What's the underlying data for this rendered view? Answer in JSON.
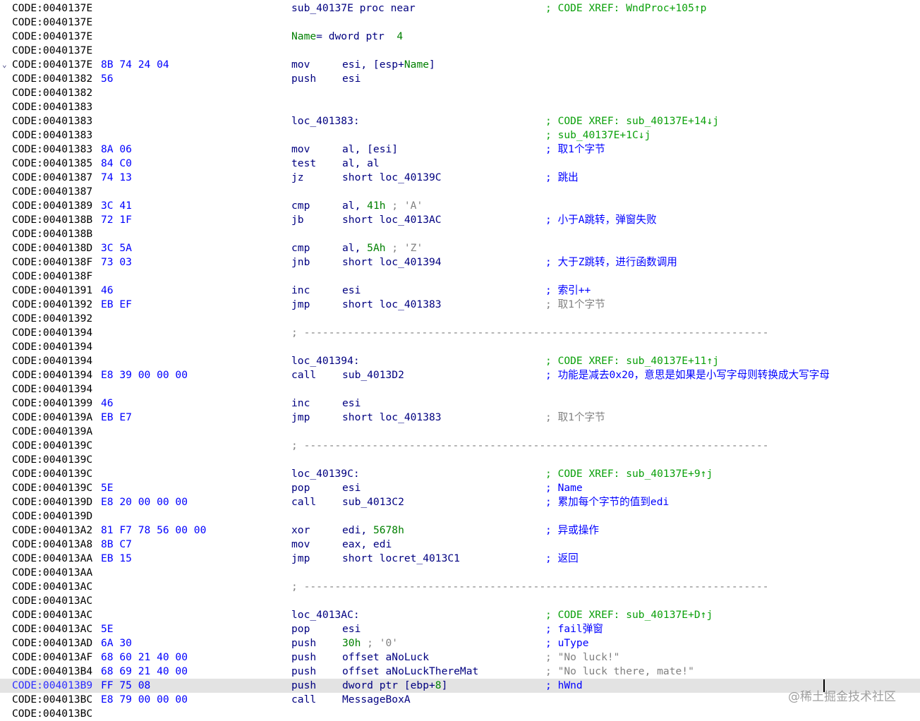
{
  "watermark": "@稀土掘金技术社区",
  "lines": [
    {
      "addr": "CODE:0040137E",
      "label": "sub_40137E proc near",
      "comment": [
        {
          "t": "; CODE XREF: WndProc+105↑p",
          "c": "gr"
        }
      ]
    },
    {
      "addr": "CODE:0040137E"
    },
    {
      "addr": "CODE:0040137E",
      "labelParts": [
        {
          "t": "Name",
          "c": "var"
        },
        {
          "t": "= dword ptr  "
        },
        {
          "t": "4",
          "c": "num"
        }
      ]
    },
    {
      "addr": "CODE:0040137E"
    },
    {
      "addr": "CODE:0040137E",
      "fold": "⌄",
      "bytes": "8B 74 24 04",
      "mnem": "mov",
      "ops": [
        {
          "t": "esi, [esp+"
        },
        {
          "t": "Name",
          "c": "var"
        },
        {
          "t": "]"
        }
      ]
    },
    {
      "addr": "CODE:00401382",
      "bytes": "56",
      "mnem": "push",
      "ops": [
        {
          "t": "esi"
        }
      ]
    },
    {
      "addr": "CODE:00401382"
    },
    {
      "addr": "CODE:00401383"
    },
    {
      "addr": "CODE:00401383",
      "label": "loc_401383:",
      "comment": [
        {
          "t": "; CODE XREF: sub_40137E+14↓j",
          "c": "gr"
        }
      ]
    },
    {
      "addr": "CODE:00401383",
      "comment": [
        {
          "t": "; sub_40137E+1C↓j",
          "c": "gr"
        }
      ]
    },
    {
      "addr": "CODE:00401383",
      "bytes": "8A 06",
      "mnem": "mov",
      "ops": [
        {
          "t": "al, [esi]"
        }
      ],
      "comment": [
        {
          "t": "; 取1个字节",
          "c": "cm"
        }
      ]
    },
    {
      "addr": "CODE:00401385",
      "bytes": "84 C0",
      "mnem": "test",
      "ops": [
        {
          "t": "al, al"
        }
      ]
    },
    {
      "addr": "CODE:00401387",
      "bytes": "74 13",
      "mnem": "jz",
      "ops": [
        {
          "t": "short loc_40139C"
        }
      ],
      "comment": [
        {
          "t": "; 跳出",
          "c": "cm"
        }
      ]
    },
    {
      "addr": "CODE:00401387"
    },
    {
      "addr": "CODE:00401389",
      "bytes": "3C 41",
      "mnem": "cmp",
      "ops": [
        {
          "t": "al, "
        },
        {
          "t": "41h",
          "c": "num"
        },
        {
          "t": " ; 'A'",
          "c": "sc"
        }
      ]
    },
    {
      "addr": "CODE:0040138B",
      "bytes": "72 1F",
      "mnem": "jb",
      "ops": [
        {
          "t": "short loc_4013AC"
        }
      ],
      "comment": [
        {
          "t": "; 小于A跳转，弹窗失败",
          "c": "cm"
        }
      ]
    },
    {
      "addr": "CODE:0040138B"
    },
    {
      "addr": "CODE:0040138D",
      "bytes": "3C 5A",
      "mnem": "cmp",
      "ops": [
        {
          "t": "al, "
        },
        {
          "t": "5Ah",
          "c": "num"
        },
        {
          "t": " ; 'Z'",
          "c": "sc"
        }
      ]
    },
    {
      "addr": "CODE:0040138F",
      "bytes": "73 03",
      "mnem": "jnb",
      "ops": [
        {
          "t": "short loc_401394"
        }
      ],
      "comment": [
        {
          "t": "; 大于Z跳转，进行函数调用",
          "c": "cm"
        }
      ]
    },
    {
      "addr": "CODE:0040138F"
    },
    {
      "addr": "CODE:00401391",
      "bytes": "46",
      "mnem": "inc",
      "ops": [
        {
          "t": "esi"
        }
      ],
      "comment": [
        {
          "t": "; 索引++",
          "c": "cm"
        }
      ]
    },
    {
      "addr": "CODE:00401392",
      "bytes": "EB EF",
      "mnem": "jmp",
      "ops": [
        {
          "t": "short loc_401383"
        }
      ],
      "comment": [
        {
          "t": "; 取1个字节",
          "c": "gy"
        }
      ]
    },
    {
      "addr": "CODE:00401392"
    },
    {
      "addr": "CODE:00401394",
      "sep": "; ---------------------------------------------------------------------------"
    },
    {
      "addr": "CODE:00401394"
    },
    {
      "addr": "CODE:00401394",
      "label": "loc_401394:",
      "comment": [
        {
          "t": "; CODE XREF: sub_40137E+11↑j",
          "c": "gr"
        }
      ]
    },
    {
      "addr": "CODE:00401394",
      "bytes": "E8 39 00 00 00",
      "mnem": "call",
      "ops": [
        {
          "t": "sub_4013D2"
        }
      ],
      "comment": [
        {
          "t": "; 功能是减去0x20，意思是如果是小写字母则转换成大写字母",
          "c": "cm"
        }
      ]
    },
    {
      "addr": "CODE:00401394"
    },
    {
      "addr": "CODE:00401399",
      "bytes": "46",
      "mnem": "inc",
      "ops": [
        {
          "t": "esi"
        }
      ]
    },
    {
      "addr": "CODE:0040139A",
      "bytes": "EB E7",
      "mnem": "jmp",
      "ops": [
        {
          "t": "short loc_401383"
        }
      ],
      "comment": [
        {
          "t": "; 取1个字节",
          "c": "gy"
        }
      ]
    },
    {
      "addr": "CODE:0040139A"
    },
    {
      "addr": "CODE:0040139C",
      "sep": "; ---------------------------------------------------------------------------"
    },
    {
      "addr": "CODE:0040139C"
    },
    {
      "addr": "CODE:0040139C",
      "label": "loc_40139C:",
      "comment": [
        {
          "t": "; CODE XREF: sub_40137E+9↑j",
          "c": "gr"
        }
      ]
    },
    {
      "addr": "CODE:0040139C",
      "bytes": "5E",
      "mnem": "pop",
      "ops": [
        {
          "t": "esi"
        }
      ],
      "comment": [
        {
          "t": "; Name",
          "c": "cm"
        }
      ]
    },
    {
      "addr": "CODE:0040139D",
      "bytes": "E8 20 00 00 00",
      "mnem": "call",
      "ops": [
        {
          "t": "sub_4013C2"
        }
      ],
      "comment": [
        {
          "t": "; 累加每个字节的值到edi",
          "c": "cm"
        }
      ]
    },
    {
      "addr": "CODE:0040139D"
    },
    {
      "addr": "CODE:004013A2",
      "bytes": "81 F7 78 56 00 00",
      "mnem": "xor",
      "ops": [
        {
          "t": "edi, "
        },
        {
          "t": "5678h",
          "c": "num"
        }
      ],
      "comment": [
        {
          "t": "; 异或操作",
          "c": "cm"
        }
      ]
    },
    {
      "addr": "CODE:004013A8",
      "bytes": "8B C7",
      "mnem": "mov",
      "ops": [
        {
          "t": "eax, edi"
        }
      ]
    },
    {
      "addr": "CODE:004013AA",
      "bytes": "EB 15",
      "mnem": "jmp",
      "ops": [
        {
          "t": "short locret_4013C1"
        }
      ],
      "comment": [
        {
          "t": "; 返回",
          "c": "cm"
        }
      ]
    },
    {
      "addr": "CODE:004013AA"
    },
    {
      "addr": "CODE:004013AC",
      "sep": "; ---------------------------------------------------------------------------"
    },
    {
      "addr": "CODE:004013AC"
    },
    {
      "addr": "CODE:004013AC",
      "label": "loc_4013AC:",
      "comment": [
        {
          "t": "; CODE XREF: sub_40137E+D↑j",
          "c": "gr"
        }
      ]
    },
    {
      "addr": "CODE:004013AC",
      "bytes": "5E",
      "mnem": "pop",
      "ops": [
        {
          "t": "esi"
        }
      ],
      "comment": [
        {
          "t": "; fail弹窗",
          "c": "cm"
        }
      ]
    },
    {
      "addr": "CODE:004013AD",
      "bytes": "6A 30",
      "mnem": "push",
      "ops": [
        {
          "t": "30h",
          "c": "num"
        },
        {
          "t": " ; '0'",
          "c": "sc"
        }
      ],
      "comment": [
        {
          "t": "; uType",
          "c": "cm"
        }
      ]
    },
    {
      "addr": "CODE:004013AF",
      "bytes": "68 60 21 40 00",
      "mnem": "push",
      "ops": [
        {
          "t": "offset aNoLuck"
        }
      ],
      "comment": [
        {
          "t": "; \"No luck!\"",
          "c": "gy"
        }
      ]
    },
    {
      "addr": "CODE:004013B4",
      "bytes": "68 69 21 40 00",
      "mnem": "push",
      "ops": [
        {
          "t": "offset aNoLuckThereMat"
        }
      ],
      "comment": [
        {
          "t": "; \"No luck there, mate!\"",
          "c": "gy"
        }
      ]
    },
    {
      "addr": "CODE:004013B9",
      "selected": true,
      "bytes": "FF 75 08",
      "mnem": "push",
      "ops": [
        {
          "t": "dword ptr [ebp+"
        },
        {
          "t": "8",
          "c": "num"
        },
        {
          "t": "]"
        }
      ],
      "comment": [
        {
          "t": "; hWnd",
          "c": "cm"
        }
      ]
    },
    {
      "addr": "CODE:004013BC",
      "bytes": "E8 79 00 00 00",
      "mnem": "call",
      "ops": [
        {
          "t": "MessageBoxA"
        }
      ]
    },
    {
      "addr": "CODE:004013BC"
    }
  ]
}
